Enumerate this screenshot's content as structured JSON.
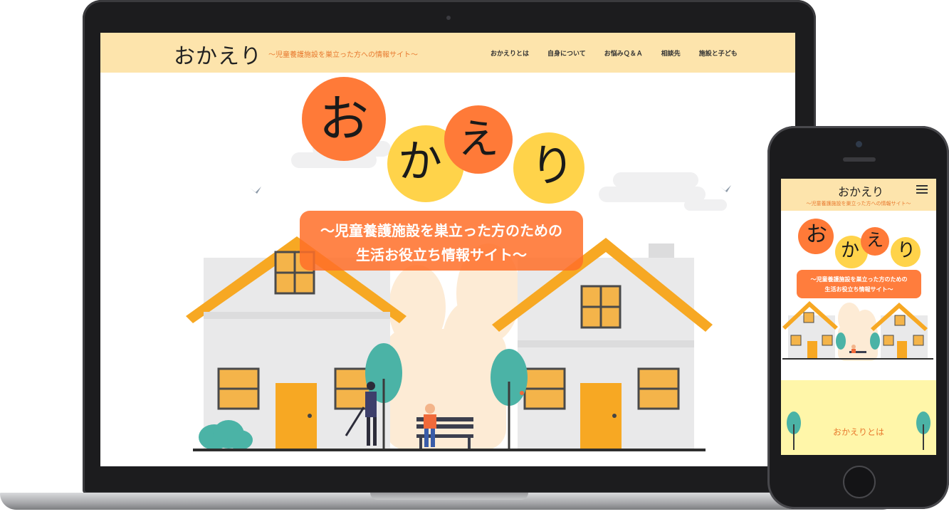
{
  "desktop": {
    "logo": "おかえり",
    "tagline": "〜児童養護施設を巣立った方への情報サイト〜",
    "nav": [
      "おかえりとは",
      "自身について",
      "お悩みＱ＆Ａ",
      "相談先",
      "施設と子ども"
    ],
    "hero": {
      "title_chars": [
        "お",
        "か",
        "え",
        "り"
      ],
      "banner_line1": "〜児童養護施設を巣立った方のための",
      "banner_line2": "生活お役立ち情報サイト〜"
    }
  },
  "mobile": {
    "logo": "おかえり",
    "tagline": "〜児童養護施設を巣立った方への情報サイト〜",
    "menu_icon": "hamburger-icon",
    "hero": {
      "title_chars": [
        "お",
        "か",
        "え",
        "り"
      ],
      "banner_line1": "〜児童養護施設を巣立った方のための",
      "banner_line2": "生活お役立ち情報サイト〜"
    },
    "about_label": "おかえりとは"
  },
  "colors": {
    "header_bg": "#fde4ac",
    "accent_orange": "#ff6f28",
    "circle_orange": "#ff7a38",
    "circle_yellow": "#ffd34a",
    "roof": "#f7a823",
    "house": "#e9e9ea",
    "tree": "#4bb3a6",
    "about_bg": "#fff6a9"
  }
}
